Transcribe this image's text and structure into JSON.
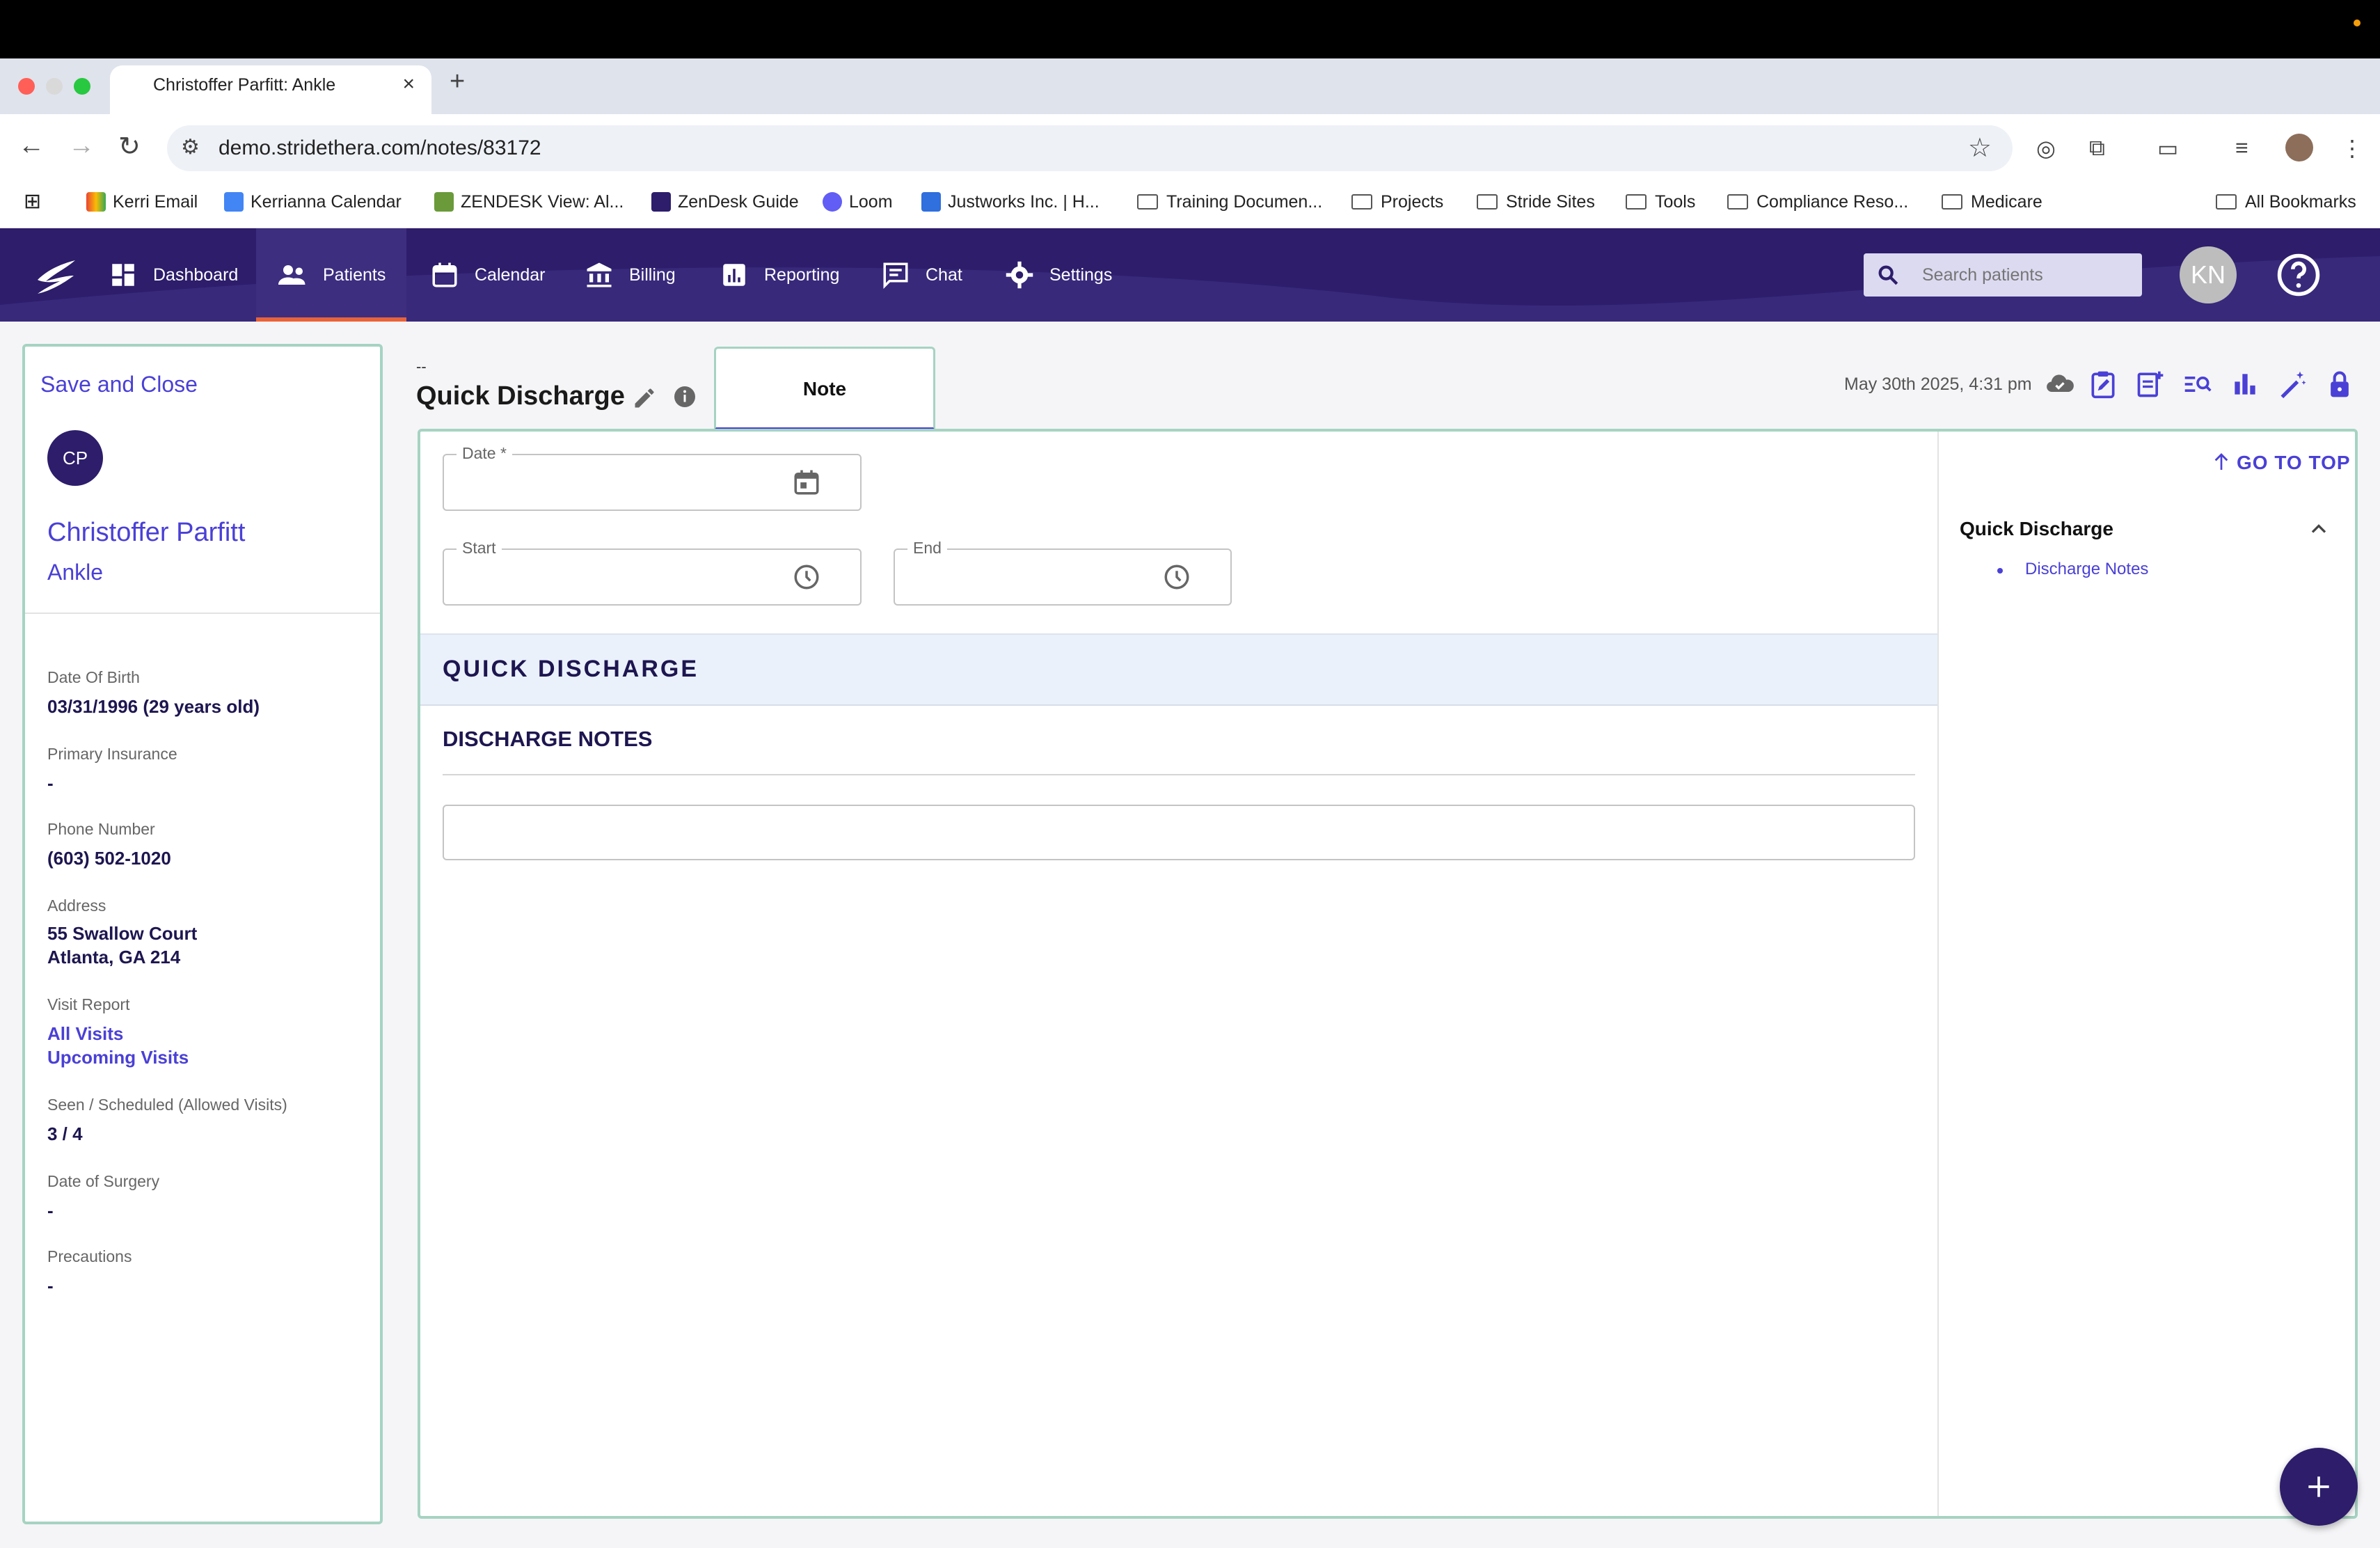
{
  "browser": {
    "tab_title": "Christoffer Parfitt: Ankle",
    "url": "demo.stridethera.com/notes/83172",
    "bookmarks": [
      {
        "label": "Kerri Email",
        "icon": "gmail-icon"
      },
      {
        "label": "Kerrianna Calendar",
        "icon": "calendar-icon"
      },
      {
        "label": "ZENDESK View: Al...",
        "icon": "zendesk-icon"
      },
      {
        "label": "ZenDesk Guide",
        "icon": "stride-icon"
      },
      {
        "label": "Loom",
        "icon": "loom-icon"
      },
      {
        "label": "Justworks Inc. | H...",
        "icon": "justworks-icon"
      },
      {
        "label": "Training Documen...",
        "icon": "folder-icon"
      },
      {
        "label": "Projects",
        "icon": "folder-icon"
      },
      {
        "label": "Stride Sites",
        "icon": "folder-icon"
      },
      {
        "label": "Tools",
        "icon": "folder-icon"
      },
      {
        "label": "Compliance Reso...",
        "icon": "folder-icon"
      },
      {
        "label": "Medicare",
        "icon": "folder-icon"
      }
    ],
    "all_bookmarks": "All Bookmarks"
  },
  "nav": {
    "items": [
      {
        "label": "Dashboard",
        "icon": "dashboard-icon"
      },
      {
        "label": "Patients",
        "icon": "people-icon"
      },
      {
        "label": "Calendar",
        "icon": "calendar-icon"
      },
      {
        "label": "Billing",
        "icon": "bank-icon"
      },
      {
        "label": "Reporting",
        "icon": "chart-icon"
      },
      {
        "label": "Chat",
        "icon": "chat-icon"
      },
      {
        "label": "Settings",
        "icon": "gear-icon"
      }
    ],
    "active": "Patients",
    "search_placeholder": "Search patients",
    "user_initials": "KN"
  },
  "patient": {
    "save_close": "Save and Close",
    "initials": "CP",
    "name": "Christoffer Parfitt",
    "case": "Ankle",
    "dob_label": "Date Of Birth",
    "dob_value": "03/31/1996 (29 years old)",
    "insurance_label": "Primary Insurance",
    "insurance_value": "-",
    "phone_label": "Phone Number",
    "phone_value": "(603) 502-1020",
    "address_label": "Address",
    "address_line1": "55 Swallow Court",
    "address_line2": "Atlanta, GA 214",
    "visit_report_label": "Visit Report",
    "all_visits": "All Visits",
    "upcoming_visits": "Upcoming Visits",
    "seen_label": "Seen / Scheduled (Allowed Visits)",
    "seen_value": "3 / 4",
    "surgery_label": "Date of Surgery",
    "surgery_value": "-",
    "precautions_label": "Precautions",
    "precautions_value": "-"
  },
  "note": {
    "dash": "--",
    "title": "Quick Discharge",
    "tab_label": "Note",
    "timestamp": "May 30th 2025, 4:31 pm",
    "date_label": "Date *",
    "start_label": "Start",
    "end_label": "End",
    "section_title": "QUICK DISCHARGE",
    "subsection_title": "DISCHARGE NOTES",
    "discharge_notes_value": ""
  },
  "toc": {
    "go_to_top": "GO TO TOP",
    "title": "Quick Discharge",
    "items": [
      "Discharge Notes"
    ]
  },
  "colors": {
    "header_bg": "#2d1d6b",
    "accent": "#4a40d6",
    "active_bar": "#e8633a",
    "panel_border": "#a6d3c2"
  }
}
